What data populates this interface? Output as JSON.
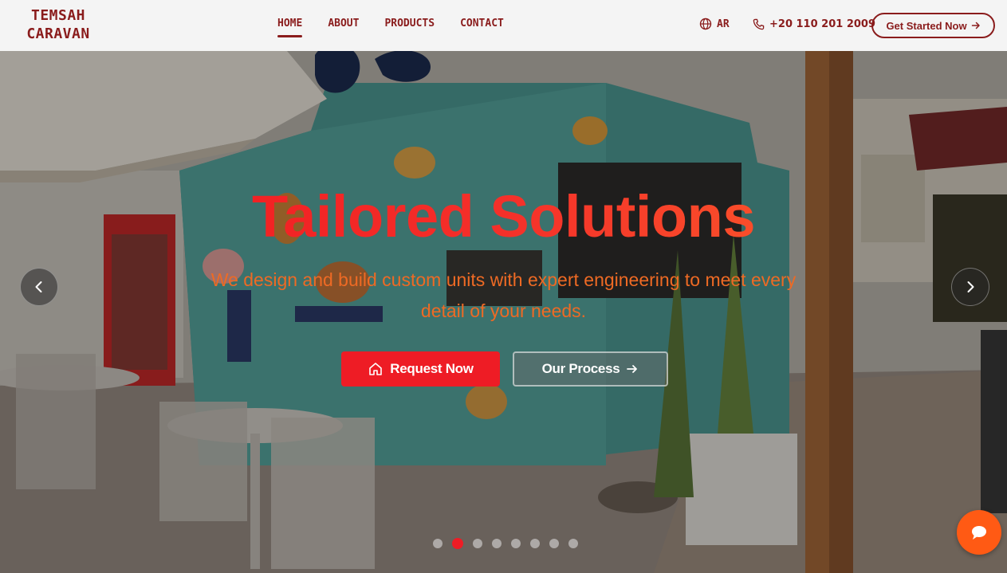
{
  "header": {
    "logo_line1": "TEMSAH",
    "logo_line2": "CARAVAN",
    "nav": [
      {
        "label": "HOME",
        "active": true
      },
      {
        "label": "ABOUT",
        "active": false
      },
      {
        "label": "PRODUCTS",
        "active": false
      },
      {
        "label": "CONTACT",
        "active": false
      }
    ],
    "language_label": "AR",
    "language_icon": "globe-icon",
    "phone_label": "+20 110 201 2009",
    "phone_icon": "phone-icon",
    "cta_label": "Get Started Now",
    "cta_icon": "arrow-right-icon"
  },
  "hero": {
    "title": "Tailored Solutions",
    "subtitle": "We design and build custom units with expert engineering to meet every detail of your needs.",
    "primary_button": {
      "label": "Request Now",
      "icon": "home-icon"
    },
    "secondary_button": {
      "label": "Our Process",
      "icon": "arrow-right-icon"
    },
    "prev_icon": "chevron-left-icon",
    "next_icon": "chevron-right-icon",
    "slide_count": 8,
    "active_slide": 2
  },
  "chat": {
    "icon": "chat-bubble-icon"
  },
  "colors": {
    "brand": "#8a1c1c",
    "accent_red": "#ee1c25",
    "accent_orange": "#ff5a14",
    "header_bg": "#f4f4f4"
  }
}
